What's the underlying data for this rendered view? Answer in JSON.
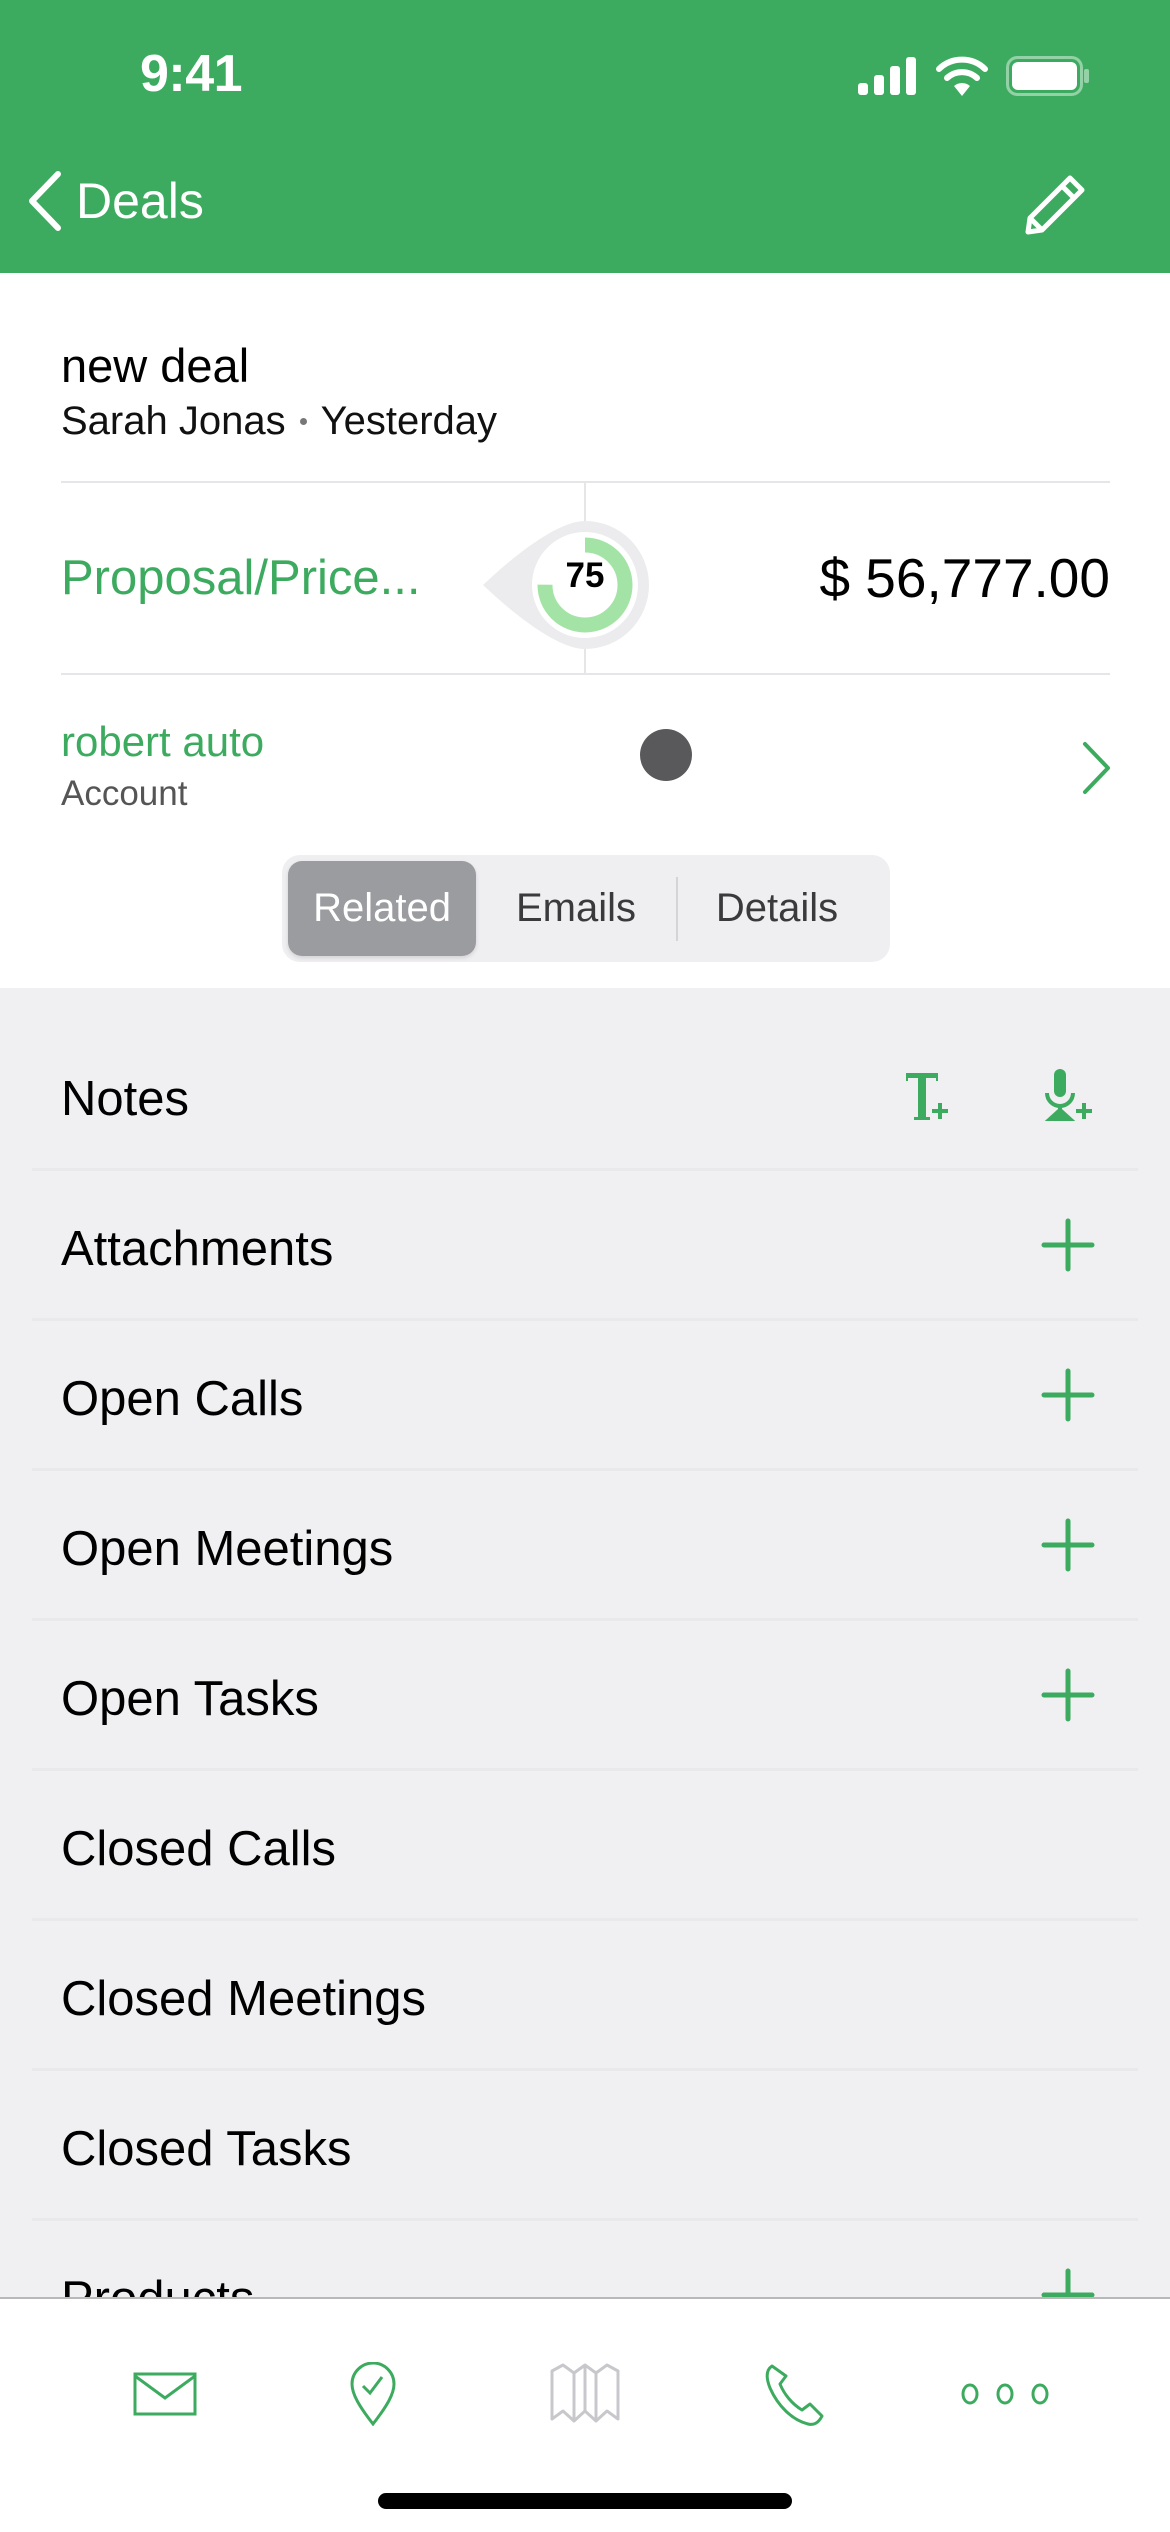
{
  "status_bar": {
    "time": "9:41",
    "icons": [
      "cellular-signal-icon",
      "wifi-icon",
      "battery-icon"
    ]
  },
  "nav": {
    "back_label": "Deals",
    "back_icon": "chevron-left-icon",
    "edit_icon": "pencil-icon"
  },
  "deal": {
    "title": "new deal",
    "owner": "Sarah Jonas",
    "date": "Yesterday",
    "stage": "Proposal/Price...",
    "probability": 75,
    "probability_text": "75",
    "amount": "$ 56,777.00"
  },
  "account": {
    "name": "robert auto",
    "label": "Account"
  },
  "segmented": {
    "selected": "Related",
    "tabs": [
      "Related",
      "Emails",
      "Details"
    ]
  },
  "related_rows": [
    {
      "label": "Notes",
      "actions": [
        "add-text-note-icon",
        "add-voice-note-icon"
      ]
    },
    {
      "label": "Attachments",
      "actions": [
        "plus-icon"
      ]
    },
    {
      "label": "Open Calls",
      "actions": [
        "plus-icon"
      ]
    },
    {
      "label": "Open Meetings",
      "actions": [
        "plus-icon"
      ]
    },
    {
      "label": "Open Tasks",
      "actions": [
        "plus-icon"
      ]
    },
    {
      "label": "Closed Calls",
      "actions": []
    },
    {
      "label": "Closed Meetings",
      "actions": []
    },
    {
      "label": "Closed Tasks",
      "actions": []
    },
    {
      "label": "Products",
      "actions": [
        "plus-icon"
      ]
    }
  ],
  "tabbar": {
    "items": [
      "mail-icon",
      "location-check-icon",
      "map-icon",
      "phone-icon",
      "more-icon"
    ]
  },
  "colors": {
    "brand_green": "#3dab5f",
    "progress_green": "#a3e4a6",
    "background_gray": "#f0eff2",
    "disabled_gray": "#c8c8cc"
  }
}
